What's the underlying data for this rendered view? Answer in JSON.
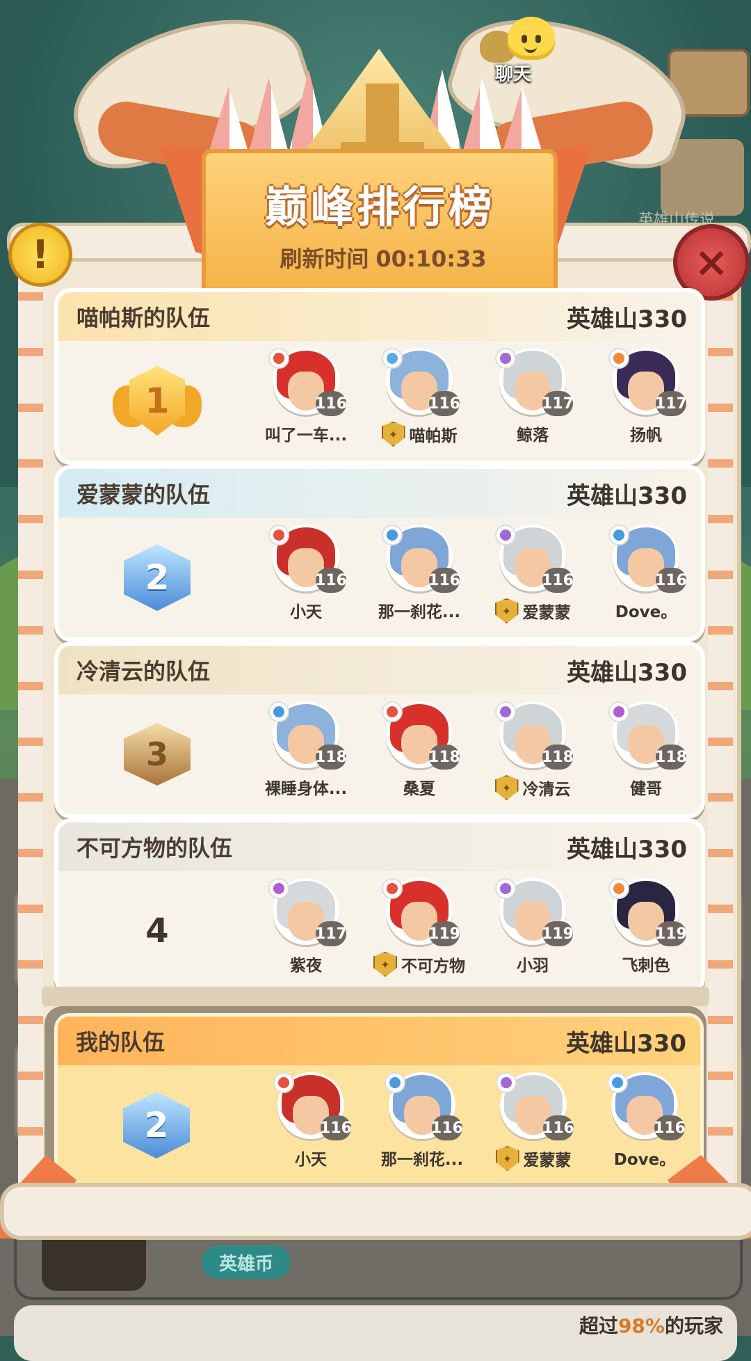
{
  "title": "巅峰排行榜",
  "refresh_label": "刷新时间",
  "refresh_time": "00:10:33",
  "chat_label": "聊天",
  "side_label": "英雄山传说",
  "help_icon": "!",
  "close_icon": "×",
  "hero_coin_label": "英雄币",
  "beat_prefix": "超过",
  "beat_pct": "98%",
  "beat_suffix": "的玩家",
  "teams": [
    {
      "name": "喵帕斯的队伍",
      "server": "英雄山330",
      "rank": "1",
      "header_color": "#fbe3ad",
      "members": [
        {
          "name": "叫了一车...",
          "level": "116",
          "leader": false,
          "elem": "#e9503d",
          "hair": "#d8312c"
        },
        {
          "name": "喵帕斯",
          "level": "116",
          "leader": true,
          "elem": "#5aa9e6",
          "hair": "#8db3dd"
        },
        {
          "name": "鲸落",
          "level": "117",
          "leader": false,
          "elem": "#a06ad3",
          "hair": "#cfd4d6"
        },
        {
          "name": "扬帆",
          "level": "117",
          "leader": false,
          "elem": "#f08a3a",
          "hair": "#3a2b58"
        }
      ]
    },
    {
      "name": "爱蒙蒙的队伍",
      "server": "英雄山330",
      "rank": "2",
      "header_color": "#d5ecf3",
      "members": [
        {
          "name": "小天",
          "level": "116",
          "leader": false,
          "elem": "#e9503d",
          "hair": "#c9302a"
        },
        {
          "name": "那一刹花...",
          "level": "116",
          "leader": false,
          "elem": "#4a9ae0",
          "hair": "#7ea7d8"
        },
        {
          "name": "爱蒙蒙",
          "level": "116",
          "leader": true,
          "elem": "#a06ad3",
          "hair": "#cfd4d6"
        },
        {
          "name": "Dove。",
          "level": "116",
          "leader": false,
          "elem": "#4a9ae0",
          "hair": "#7ea7d8"
        }
      ]
    },
    {
      "name": "冷清云的队伍",
      "server": "英雄山330",
      "rank": "3",
      "header_color": "#efe2c4",
      "members": [
        {
          "name": "裸睡身体...",
          "level": "118",
          "leader": false,
          "elem": "#4a9ae0",
          "hair": "#8db3dd"
        },
        {
          "name": "桑夏",
          "level": "118",
          "leader": false,
          "elem": "#e9503d",
          "hair": "#d8312c"
        },
        {
          "name": "冷清云",
          "level": "118",
          "leader": true,
          "elem": "#a06ad3",
          "hair": "#cfd4d6"
        },
        {
          "name": "健哥",
          "level": "118",
          "leader": false,
          "elem": "#b45ad3",
          "hair": "#d5d9dc"
        }
      ]
    },
    {
      "name": "不可方物的队伍",
      "server": "英雄山330",
      "rank": "4",
      "header_color": "#e9e6df",
      "members": [
        {
          "name": "紫夜",
          "level": "117",
          "leader": false,
          "elem": "#b45ad3",
          "hair": "#d5d9dc"
        },
        {
          "name": "不可方物",
          "level": "119",
          "leader": true,
          "elem": "#e9503d",
          "hair": "#d8312c"
        },
        {
          "name": "小羽",
          "level": "119",
          "leader": false,
          "elem": "#a06ad3",
          "hair": "#cfd4d6"
        },
        {
          "name": "飞刺色",
          "level": "119",
          "leader": false,
          "elem": "#f08a3a",
          "hair": "#2a2540"
        }
      ]
    }
  ],
  "my_team": {
    "name": "我的队伍",
    "server": "英雄山330",
    "rank": "2",
    "members": [
      {
        "name": "小天",
        "level": "116",
        "leader": false,
        "elem": "#e9503d",
        "hair": "#c9302a"
      },
      {
        "name": "那一刹花...",
        "level": "116",
        "leader": false,
        "elem": "#4a9ae0",
        "hair": "#7ea7d8"
      },
      {
        "name": "爱蒙蒙",
        "level": "116",
        "leader": true,
        "elem": "#a06ad3",
        "hair": "#cfd4d6"
      },
      {
        "name": "Dove。",
        "level": "116",
        "leader": false,
        "elem": "#4a9ae0",
        "hair": "#7ea7d8"
      }
    ]
  }
}
